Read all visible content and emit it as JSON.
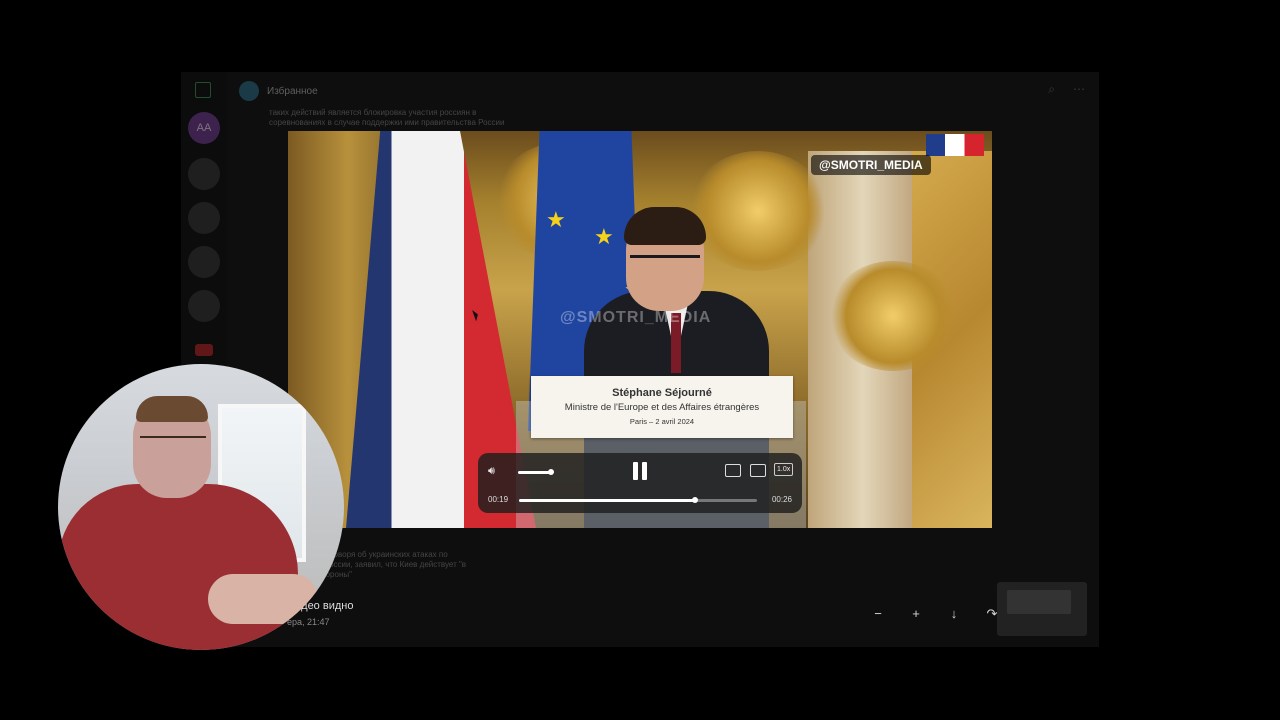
{
  "chat": {
    "title": "Избранное",
    "left_rail_avatar": "AA",
    "bg_snippets": [
      "таких действий является блокировка участия россиян в",
      "соревнованиях в случае поддержки ими правительства России",
      "мящий, говоря об украинских атаках по",
      "рам в России, заявил, что Киев действует \"в",
      "ной обороны\""
    ],
    "caption": "идео видно",
    "caption_time": "ера, 21:47"
  },
  "video": {
    "watermark": "@SMOTRI_MEDIA",
    "watermark_center": "@SMOTRI_MEDIA",
    "plate_name": "Stéphane Séjourné",
    "plate_role": "Ministre de l'Europe et des Affaires étrangères",
    "plate_date": "Paris – 2 avril 2024"
  },
  "player": {
    "time_current": "00:19",
    "time_total": "00:26",
    "progress_fraction": 0.74,
    "volume_fraction": 0.9,
    "speed_label": "1.0x",
    "state": "playing"
  },
  "toolbar": {
    "zoom_out": "−",
    "zoom_in": "+",
    "download": "↓",
    "share": "↷",
    "more": "•••"
  },
  "icons": {
    "volume": "speaker-icon",
    "pause": "pause-icon",
    "pip": "pip-icon",
    "fullscreen": "fullscreen-icon",
    "search": "search-icon"
  }
}
